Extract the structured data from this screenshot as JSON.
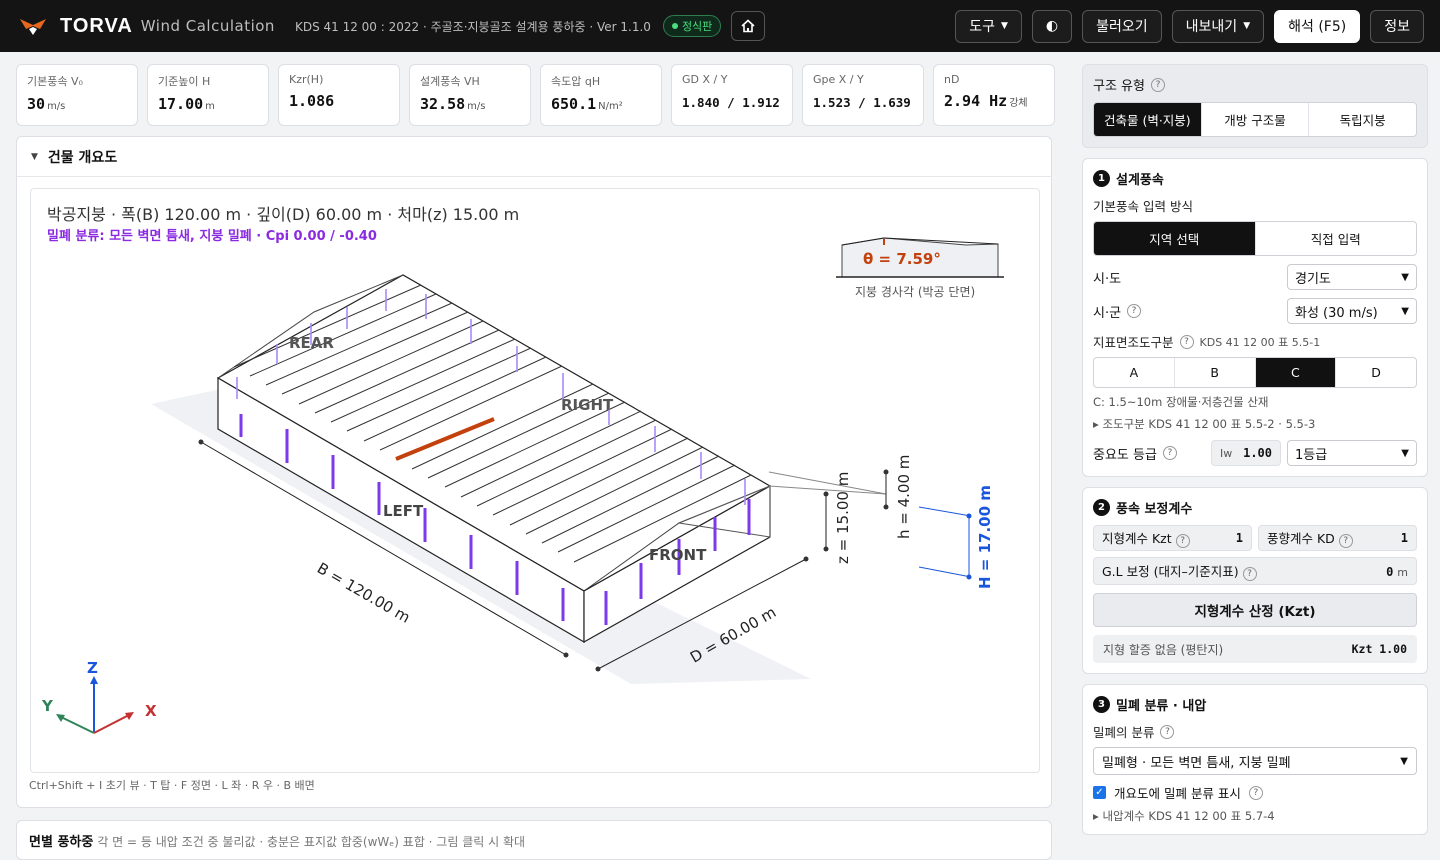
{
  "header": {
    "brand": "TORVA",
    "brand_sub": "Wind Calculation",
    "standard": "KDS 41 12 00 : 2022 · 주골조·지붕골조 설계용 풍하중 · Ver 1.1.0",
    "badge": "정식판",
    "tools": "도구",
    "load": "불러오기",
    "export": "내보내기",
    "analyze": "해석 (F5)",
    "info": "정보"
  },
  "metrics": [
    {
      "label": "기본풍속 V₀",
      "value": "30",
      "unit": "m/s"
    },
    {
      "label": "기준높이 H",
      "value": "17.00",
      "unit": "m"
    },
    {
      "label": "Kzr(H)",
      "value": "1.086",
      "unit": ""
    },
    {
      "label": "설계풍속 VH",
      "value": "32.58",
      "unit": "m/s"
    },
    {
      "label": "속도압 qH",
      "value": "650.1",
      "unit": "N/m²"
    },
    {
      "label": "GD X / Y",
      "value": "1.840 / 1.912",
      "unit": ""
    },
    {
      "label": "Gpe X / Y",
      "value": "1.523 / 1.639",
      "unit": ""
    },
    {
      "label": "nD",
      "value": "2.94 Hz",
      "unit": "강체"
    }
  ],
  "overview": {
    "title": "건물 개요도",
    "line1": "박공지붕 · 폭(B) 120.00 m · 깊이(D) 60.00 m · 처마(z) 15.00 m",
    "line2": "밀폐 분류: 모든 벽면 틈새, 지붕 밀폐 · Cpi 0.00 / -0.40",
    "theta": "θ = 7.59°",
    "theta_caption": "지붕 경사각 (박공 단면)",
    "dim_B": "B = 120.00 m",
    "dim_D": "D = 60.00 m",
    "dim_z": "z = 15.00 m",
    "dim_h": "h = 4.00 m",
    "dim_H": "H = 17.00 m",
    "face_rear": "REAR",
    "face_right": "RIGHT",
    "face_left": "LEFT",
    "face_front": "FRONT",
    "axis_x": "X",
    "axis_y": "Y",
    "axis_z": "Z",
    "hint": "Ctrl+Shift + I 초기 뷰 · T 탑 · F 정면 · L 좌 · R 우 · B 배면"
  },
  "bottom": {
    "title": "면별 풍하중",
    "desc": "각 면 = 등 내압 조건 중 불리값 · 충분은 표지값 합중(wWₑ) 표합 · 그림 클릭 시 확대"
  },
  "side": {
    "type_title": "구조 유형",
    "types": [
      "건축물 (벽·지붕)",
      "개방 구조물",
      "독립지붕"
    ],
    "s1_title": "설계풍속",
    "input_method": "기본풍속 입력 방식",
    "methods": [
      "지역 선택",
      "직접 입력"
    ],
    "sido_label": "시·도",
    "sido": "경기도",
    "sigun_label": "시·군",
    "sigun": "화성 (30 m/s)",
    "rough_label": "지표면조도구분",
    "rough_ref": "KDS 41 12 00 표 5.5-1",
    "rough": [
      "A",
      "B",
      "C",
      "D"
    ],
    "rough_desc": "C: 1.5~10m 장애물·저층건물 산재",
    "rough_more": "조도구분 KDS 41 12 00 표 5.5-2 · 5.5-3",
    "imp_label": "중요도 등급",
    "iw": "1.00",
    "imp": "1등급",
    "s2_title": "풍속 보정계수",
    "kzt_label": "지형계수 Kzt",
    "kzt": "1",
    "kd_label": "풍향계수 KD",
    "kd": "1",
    "gl_label": "G.L 보정 (대지–기준지표)",
    "gl": "0",
    "gl_unit": "m",
    "kzt_btn": "지형계수 산정 (Kzt)",
    "kzt_info": "지형 할증 없음 (평탄지)",
    "kzt_val": "Kzt 1.00",
    "s3_title": "밀폐 분류 · 내압",
    "encl_label": "밀폐의 분류",
    "encl": "밀폐형 · 모든 벽면 틈새, 지붕 밀폐",
    "show_label": "개요도에 밀폐 분류 표시",
    "cpi_more": "내압계수 KDS 41 12 00 표 5.7-4"
  }
}
